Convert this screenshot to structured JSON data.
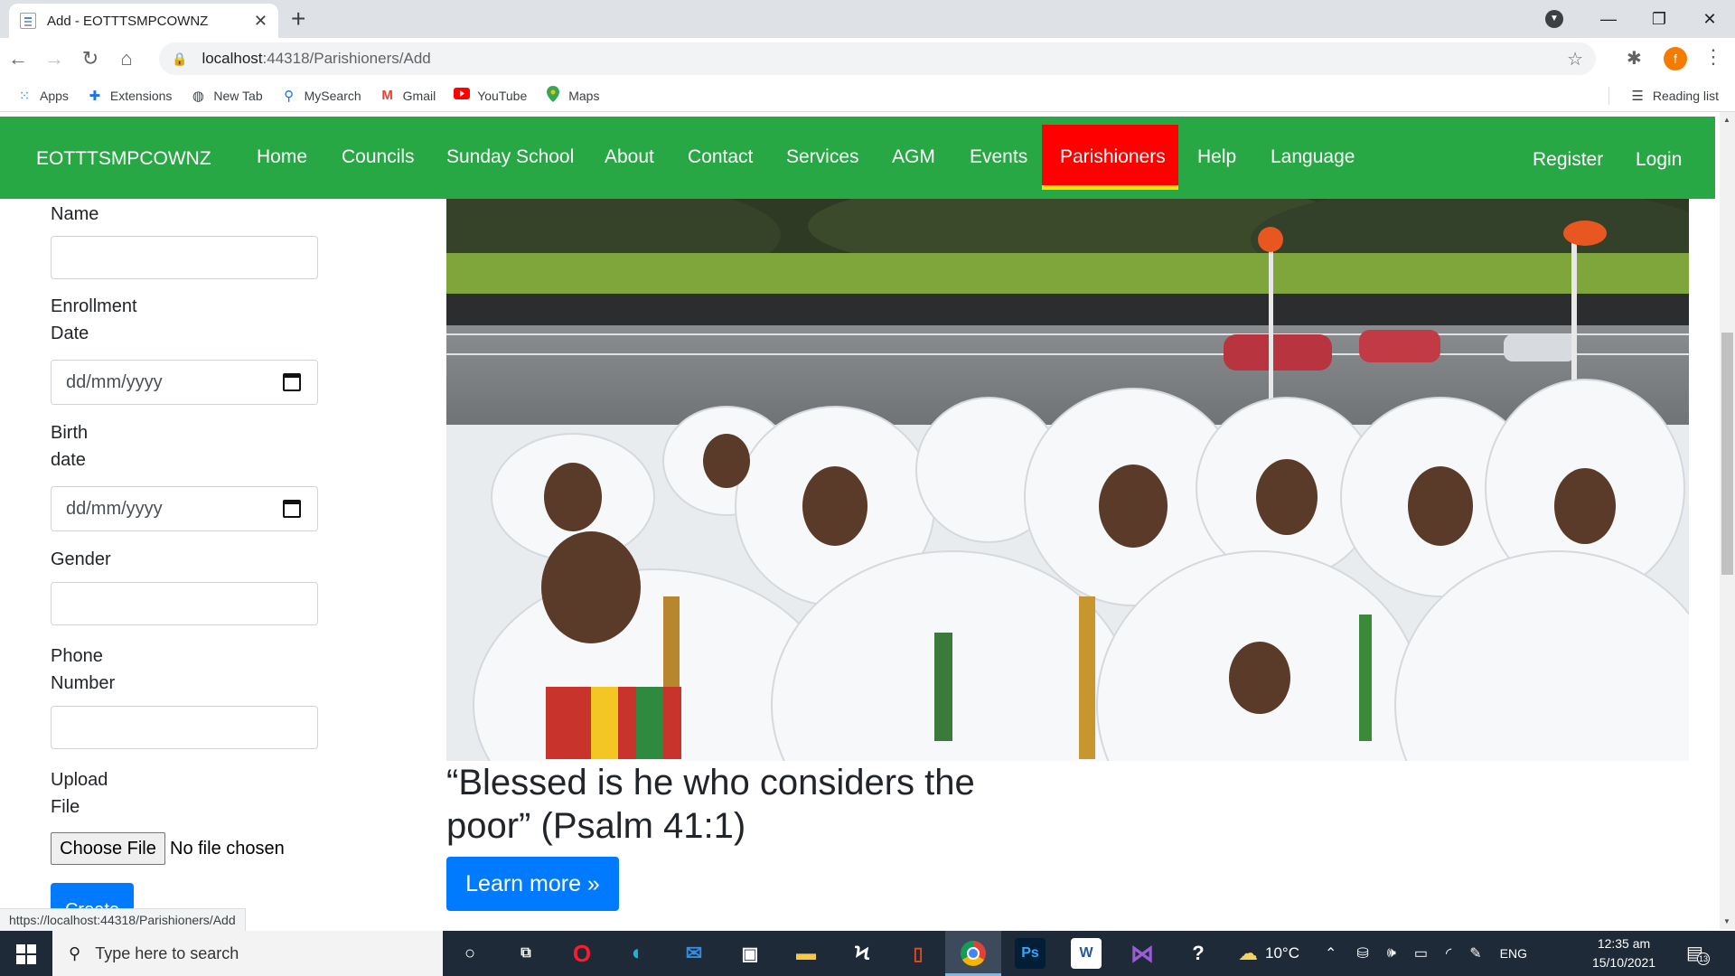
{
  "browser": {
    "tab_title": "Add - EOTTTSMPCOWNZ",
    "url_host": "localhost",
    "url_path": ":44318/Parishioners/Add",
    "status_url": "https://localhost:44318/Parishioners/Add",
    "avatar_letter": "f",
    "bookmarks": [
      {
        "label": "Apps",
        "icon": "apps-grid-icon"
      },
      {
        "label": "Extensions",
        "icon": "puzzle-icon"
      },
      {
        "label": "New Tab",
        "icon": "globe-icon"
      },
      {
        "label": "MySearch",
        "icon": "search-icon"
      },
      {
        "label": "Gmail",
        "icon": "gmail-icon"
      },
      {
        "label": "YouTube",
        "icon": "youtube-icon"
      },
      {
        "label": "Maps",
        "icon": "maps-pin-icon"
      }
    ],
    "reading_list": "Reading list"
  },
  "navbar": {
    "brand": "EOTTTSMPCOWNZ",
    "links": [
      "Home",
      "Councils",
      "Sunday School",
      "About",
      "Contact",
      "Services",
      "AGM",
      "Events",
      "Parishioners",
      "Help",
      "Language"
    ],
    "active": "Parishioners",
    "register": "Register",
    "login": "Login",
    "colors": {
      "bg": "#28a745",
      "active_bg": "#ff0000",
      "active_underline": "#ffde00"
    }
  },
  "form": {
    "name_label": "Name",
    "enrollment_label_1": "Enrollment",
    "enrollment_label_2": "Date",
    "date_placeholder": "dd/mm/yyyy",
    "birth_label_1": "Birth",
    "birth_label_2": "date",
    "gender_label": "Gender",
    "phone_label_1": "Phone",
    "phone_label_2": "Number",
    "upload_label_1": "Upload",
    "upload_label_2": "File",
    "choose_file": "Choose File",
    "no_file": "No file chosen",
    "create": "Create"
  },
  "hero": {
    "quote": "“Blessed is he who considers the poor” (Psalm 41:1)",
    "button": "Learn more »"
  },
  "taskbar": {
    "search_placeholder": "Type here to search",
    "weather": "10°C",
    "lang": "ENG",
    "time": "12:35 am",
    "date": "15/10/2021",
    "notifications": "13"
  }
}
